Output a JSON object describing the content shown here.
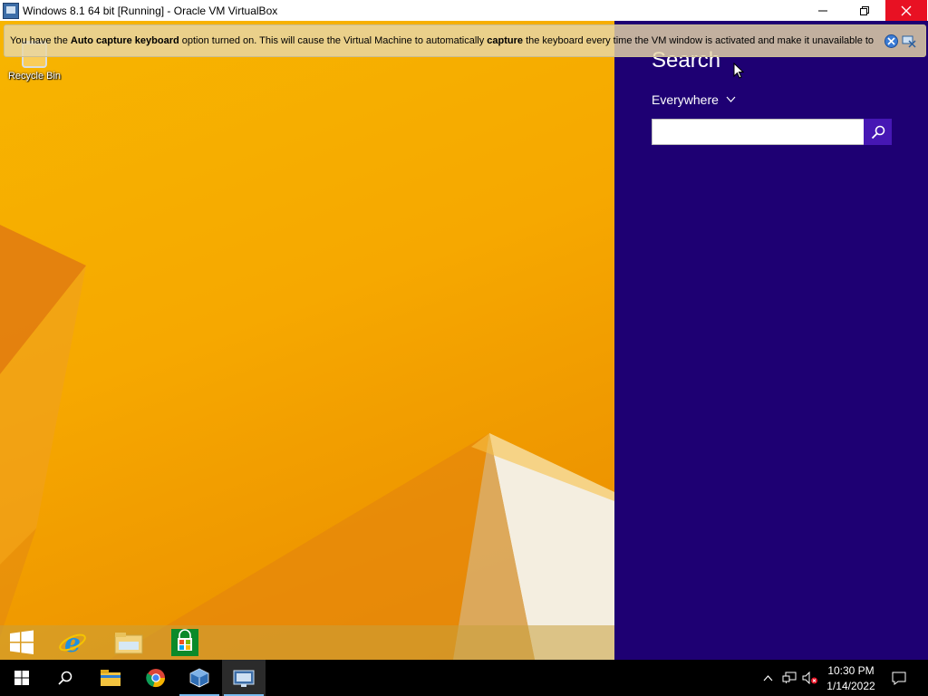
{
  "window": {
    "title": "Windows 8.1 64 bit [Running] - Oracle VM VirtualBox",
    "minimize": "—",
    "restore": "❐",
    "close": "✕"
  },
  "notice": {
    "part1": "You have the ",
    "bold1": "Auto capture keyboard",
    "part2": " option turned on. This will cause the Virtual Machine to automatically ",
    "bold2": "capture",
    "part3": " the keyboard every time the VM window is activated and make it unavailable to",
    "info_icon": "info-icon",
    "close_icon": "close-icon"
  },
  "desktop": {
    "recycle_bin": "Recycle Bin"
  },
  "search_charm": {
    "heading": "Search",
    "scope": "Everywhere",
    "query": "",
    "accent_color": "#1e0073",
    "button_color": "#4617b4"
  },
  "vm_taskbar": {
    "items": [
      "start-icon",
      "internet-explorer-icon",
      "file-explorer-icon",
      "store-icon"
    ]
  },
  "host_taskbar": {
    "items": [
      "start-icon",
      "search-icon",
      "file-explorer-icon",
      "chrome-icon",
      "virtualbox-icon",
      "virtualbox-vm-icon"
    ],
    "tray": [
      "chevron-up-icon",
      "network-icon",
      "volume-muted-icon",
      "notification-icon"
    ],
    "time": "10:30 PM",
    "date": "1/14/2022"
  }
}
